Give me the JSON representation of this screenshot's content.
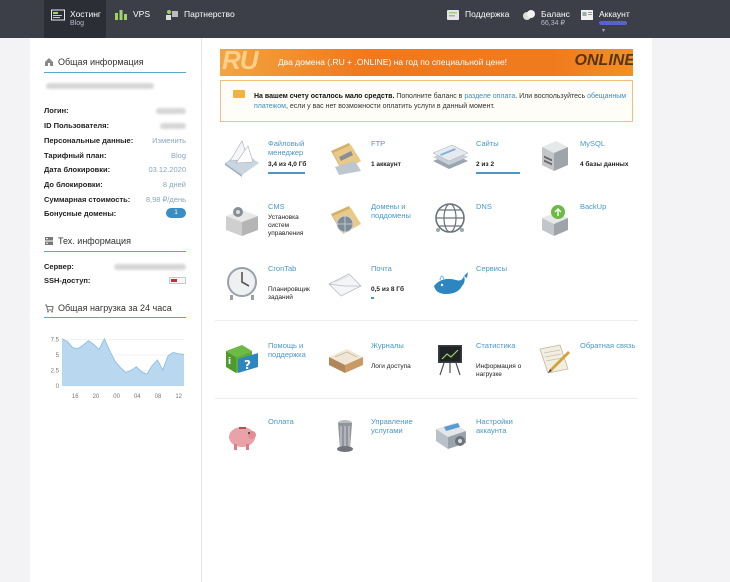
{
  "topbar": {
    "hosting_label": "Хостинг",
    "hosting_sub": "Blog",
    "vps_label": "VPS",
    "partner_label": "Партнерство",
    "support_label": "Поддержка",
    "balance_label": "Баланс",
    "balance_value": "66,34 ₽",
    "account_label": "Аккаунт"
  },
  "general": {
    "title": "Общая информация",
    "rows": [
      {
        "key": "Логин:",
        "value": ""
      },
      {
        "key": "ID Пользователя:",
        "value": ""
      },
      {
        "key": "Персональные данные:",
        "value": "Изменить"
      },
      {
        "key": "Тарифный план:",
        "value": "Blog"
      },
      {
        "key": "Дата блокировки:",
        "value": "03.12.2020"
      },
      {
        "key": "До блокировки:",
        "value": "8 дней"
      },
      {
        "key": "Суммарная стоимость:",
        "value": "8,98 ₽/день"
      },
      {
        "key": "Бонусные домены:",
        "value": "1"
      }
    ]
  },
  "tech": {
    "title": "Тех. информация",
    "rows": [
      {
        "key": "Сервер:",
        "value": ""
      },
      {
        "key": "SSH-доступ:",
        "value": ""
      }
    ]
  },
  "load": {
    "title": "Общая нагрузка за 24 часа"
  },
  "chart_data": {
    "type": "area",
    "x_ticks": [
      "16",
      "20",
      "00",
      "04",
      "08",
      "12"
    ],
    "y_ticks": [
      "7.5",
      "5",
      "2.5",
      "0"
    ],
    "ylim": [
      0,
      10
    ],
    "x": [
      0,
      1,
      2,
      3,
      4,
      5,
      6,
      7,
      8,
      9,
      10,
      11,
      12,
      13,
      14,
      15,
      16,
      17,
      18,
      19,
      20,
      21,
      22,
      23
    ],
    "values": [
      7.6,
      7.2,
      6.2,
      6.0,
      6.6,
      7.3,
      6.7,
      5.9,
      7.6,
      5.7,
      4.0,
      3.0,
      2.2,
      2.5,
      3.1,
      2.3,
      1.9,
      3.3,
      4.2,
      2.6,
      4.9,
      5.4,
      5.2,
      5.1
    ],
    "grid": true,
    "colors": {
      "fill": "#b9d8f0",
      "line": "#8bbfe4"
    }
  },
  "promo": {
    "ru_text": "RU",
    "text": "Два домена (.RU + .ONLINE) на год по специальной цене!",
    "online_text": "ONLINE"
  },
  "notice": {
    "strong": "На вашем счету осталось мало средств.",
    "part1": " Пополните баланс в ",
    "link1": "разделе оплата",
    "part2": ". Или воспользуйтесь ",
    "link2": "обещанным платежом",
    "part3": ", если у вас нет возможности оплатить услуги в данный момент."
  },
  "tiles": [
    {
      "name": "Файловый менеджер",
      "desc": "3,4 из 4,0 Гб",
      "id": "file-manager"
    },
    {
      "name": "FTP",
      "desc": "1 аккаунт",
      "id": "ftp"
    },
    {
      "name": "Сайты",
      "desc": "2 из 2",
      "id": "sites"
    },
    {
      "name": "MySQL",
      "desc": "4 базы данных",
      "id": "mysql"
    },
    {
      "name": "CMS",
      "desc": "Установка систем управления",
      "id": "cms"
    },
    {
      "name": "Домены и поддомены",
      "desc": "",
      "id": "domains"
    },
    {
      "name": "DNS",
      "desc": "",
      "id": "dns"
    },
    {
      "name": "BackUp",
      "desc": "",
      "id": "backup"
    },
    {
      "name": "CronTab",
      "desc": "Планировщик заданий",
      "id": "crontab"
    },
    {
      "name": "Почта",
      "desc": "0,5 из 8 Гб",
      "id": "mail"
    },
    {
      "name": "Сервисы",
      "desc": "",
      "id": "services"
    },
    {
      "name": "Помощь и поддержка",
      "desc": "",
      "id": "help"
    },
    {
      "name": "Журналы",
      "desc": "Логи доступа",
      "id": "logs"
    },
    {
      "name": "Статистика",
      "desc": "Информация о нагрузке",
      "id": "statistics"
    },
    {
      "name": "Обратная связь",
      "desc": "",
      "id": "feedback"
    },
    {
      "name": "Оплата",
      "desc": "",
      "id": "payment"
    },
    {
      "name": "Управление услугами",
      "desc": "",
      "id": "service-management"
    },
    {
      "name": "Настройки аккаунта",
      "desc": "",
      "id": "account-settings"
    }
  ],
  "tile_progress": {
    "file_manager": 0.85,
    "mail": 0.07,
    "sites": 1.0
  }
}
